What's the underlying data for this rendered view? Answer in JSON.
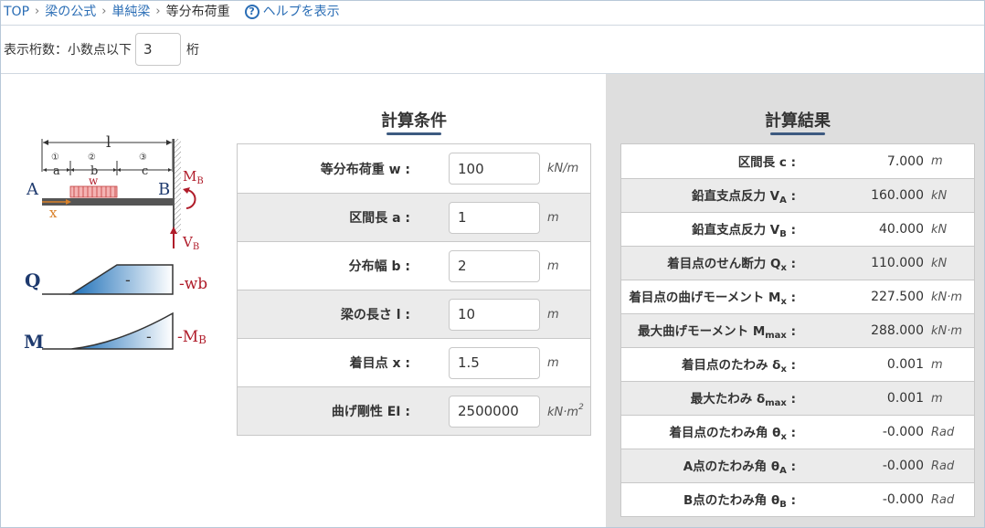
{
  "breadcrumb": {
    "items": [
      "TOP",
      "梁の公式",
      "単純梁"
    ],
    "current": "等分布荷重",
    "help": "ヘルプを表示",
    "help_icon": "?"
  },
  "digits": {
    "label_before": "表示桁数：小数点以下",
    "value": "3",
    "label_after": "桁"
  },
  "diagram": {
    "labels": {
      "l": "l",
      "a": "a",
      "b": "b",
      "c": "c",
      "n1": "①",
      "n2": "②",
      "n3": "③",
      "w": "w",
      "A": "A",
      "B": "B",
      "x": "x",
      "M": "M",
      "MB_sub": "B",
      "V": "V",
      "VB_sub": "B",
      "Q": "Q",
      "Mdiag": "M",
      "minus": "-",
      "wb": "-wb",
      "negM": "-M",
      "negM_sub": "B"
    },
    "colors": {
      "load": "#e87a7a",
      "red": "#b01c2a",
      "blue": "#1e3a6e",
      "fill_blue": "#2c7fc4"
    }
  },
  "conditions": {
    "title": "計算条件",
    "rows": [
      {
        "label": "等分布荷重",
        "symbol": "w",
        "value": "100",
        "unit": "kN/m",
        "unit_sup": ""
      },
      {
        "label": "区間長",
        "symbol": "a",
        "value": "1",
        "unit": "m",
        "unit_sup": ""
      },
      {
        "label": "分布幅",
        "symbol": "b",
        "value": "2",
        "unit": "m",
        "unit_sup": ""
      },
      {
        "label": "梁の長さ",
        "symbol": "l",
        "value": "10",
        "unit": "m",
        "unit_sup": ""
      },
      {
        "label": "着目点",
        "symbol": "x",
        "value": "1.5",
        "unit": "m",
        "unit_sup": ""
      },
      {
        "label": "曲げ剛性",
        "symbol": "EI",
        "value": "2500000",
        "unit": "kN·m",
        "unit_sup": "2"
      }
    ]
  },
  "results": {
    "title": "計算結果",
    "rows": [
      {
        "label": "区間長 c",
        "sub": "",
        "value": "7.000",
        "unit": "m"
      },
      {
        "label": "鉛直支点反力 V",
        "sub": "A",
        "value": "160.000",
        "unit": "kN"
      },
      {
        "label": "鉛直支点反力 V",
        "sub": "B",
        "value": "40.000",
        "unit": "kN"
      },
      {
        "label": "着目点のせん断力 Q",
        "sub": "x",
        "value": "110.000",
        "unit": "kN"
      },
      {
        "label": "着目点の曲げモーメント M",
        "sub": "x",
        "value": "227.500",
        "unit": "kN·m"
      },
      {
        "label": "最大曲げモーメント M",
        "sub": "max",
        "value": "288.000",
        "unit": "kN·m"
      },
      {
        "label": "着目点のたわみ δ",
        "sub": "x",
        "value": "0.001",
        "unit": "m"
      },
      {
        "label": "最大たわみ δ",
        "sub": "max",
        "value": "0.001",
        "unit": "m"
      },
      {
        "label": "着目点のたわみ角 θ",
        "sub": "x",
        "value": "-0.000",
        "unit": "Rad"
      },
      {
        "label": "A点のたわみ角 θ",
        "sub": "A",
        "value": "-0.000",
        "unit": "Rad"
      },
      {
        "label": "B点のたわみ角 θ",
        "sub": "B",
        "value": "-0.000",
        "unit": "Rad"
      }
    ]
  }
}
